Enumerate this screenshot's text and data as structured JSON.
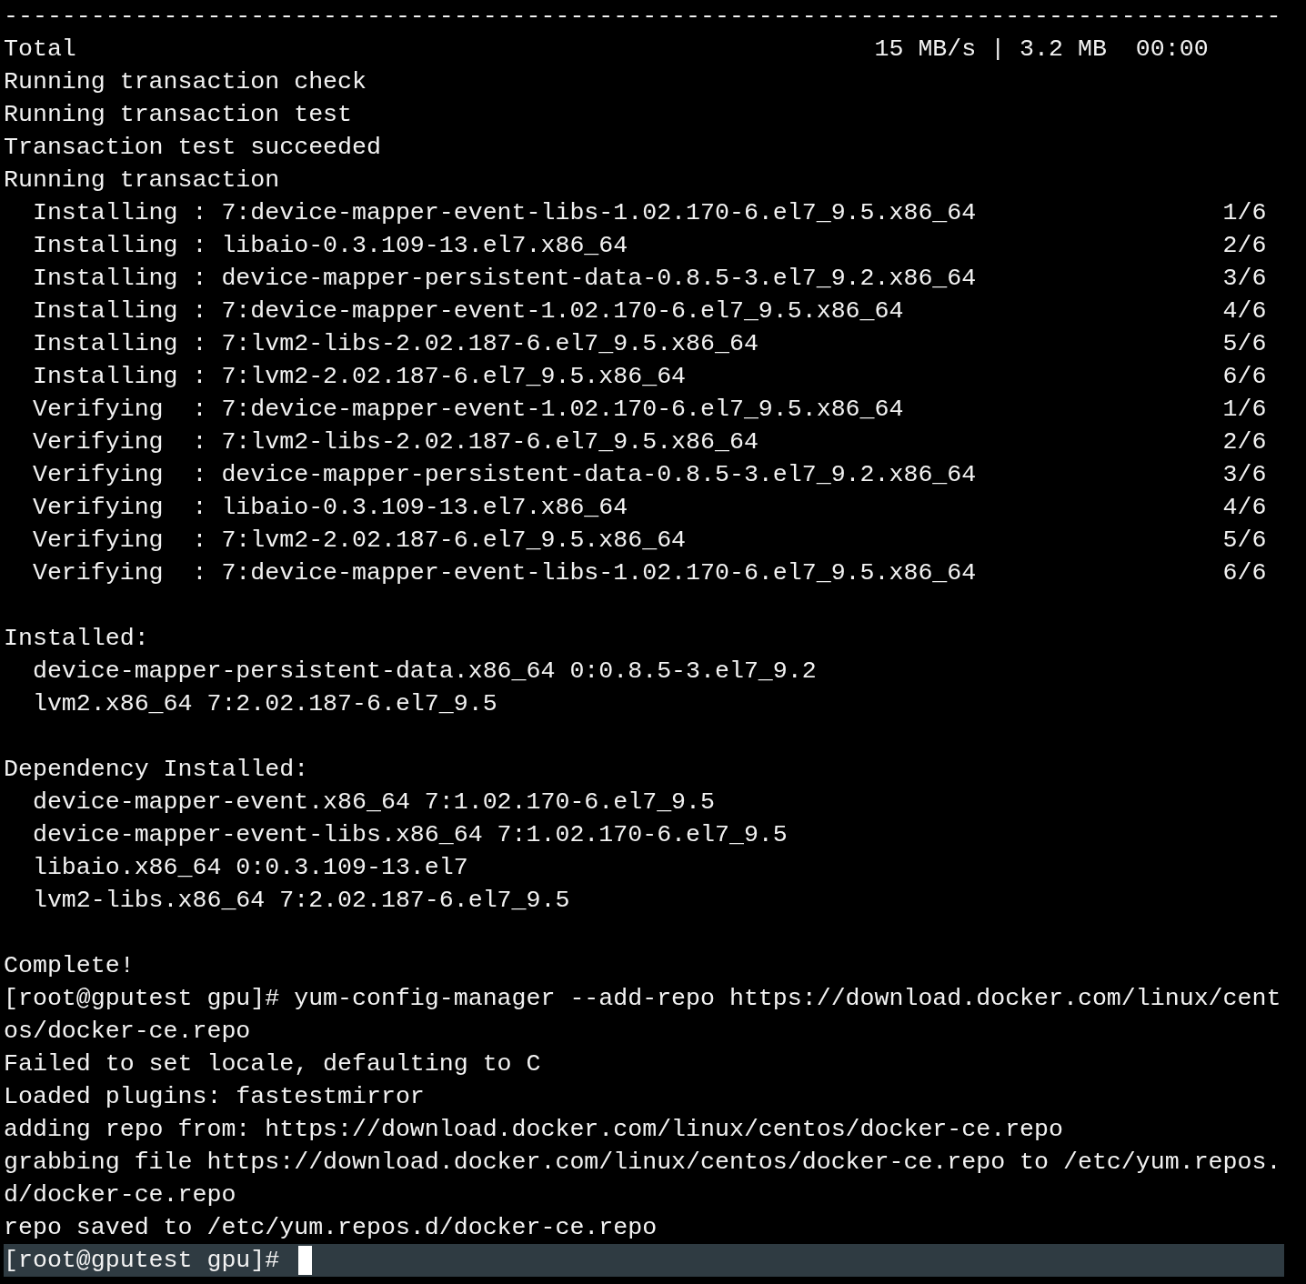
{
  "terminal": {
    "lines": [
      {
        "kind": "output",
        "text": "----------------------------------------------------------------------------------------"
      },
      {
        "kind": "output",
        "text": "Total                                                       15 MB/s | 3.2 MB  00:00"
      },
      {
        "kind": "output",
        "text": "Running transaction check"
      },
      {
        "kind": "output",
        "text": "Running transaction test"
      },
      {
        "kind": "output",
        "text": "Transaction test succeeded"
      },
      {
        "kind": "output",
        "text": "Running transaction"
      },
      {
        "kind": "output",
        "text": "  Installing : 7:device-mapper-event-libs-1.02.170-6.el7_9.5.x86_64                 1/6"
      },
      {
        "kind": "output",
        "text": "  Installing : libaio-0.3.109-13.el7.x86_64                                         2/6"
      },
      {
        "kind": "output",
        "text": "  Installing : device-mapper-persistent-data-0.8.5-3.el7_9.2.x86_64                 3/6"
      },
      {
        "kind": "output",
        "text": "  Installing : 7:device-mapper-event-1.02.170-6.el7_9.5.x86_64                      4/6"
      },
      {
        "kind": "output",
        "text": "  Installing : 7:lvm2-libs-2.02.187-6.el7_9.5.x86_64                                5/6"
      },
      {
        "kind": "output",
        "text": "  Installing : 7:lvm2-2.02.187-6.el7_9.5.x86_64                                     6/6"
      },
      {
        "kind": "output",
        "text": "  Verifying  : 7:device-mapper-event-1.02.170-6.el7_9.5.x86_64                      1/6"
      },
      {
        "kind": "output",
        "text": "  Verifying  : 7:lvm2-libs-2.02.187-6.el7_9.5.x86_64                                2/6"
      },
      {
        "kind": "output",
        "text": "  Verifying  : device-mapper-persistent-data-0.8.5-3.el7_9.2.x86_64                 3/6"
      },
      {
        "kind": "output",
        "text": "  Verifying  : libaio-0.3.109-13.el7.x86_64                                         4/6"
      },
      {
        "kind": "output",
        "text": "  Verifying  : 7:lvm2-2.02.187-6.el7_9.5.x86_64                                     5/6"
      },
      {
        "kind": "output",
        "text": "  Verifying  : 7:device-mapper-event-libs-1.02.170-6.el7_9.5.x86_64                 6/6"
      },
      {
        "kind": "blank"
      },
      {
        "kind": "output",
        "text": "Installed:"
      },
      {
        "kind": "output",
        "text": "  device-mapper-persistent-data.x86_64 0:0.8.5-3.el7_9.2"
      },
      {
        "kind": "output",
        "text": "  lvm2.x86_64 7:2.02.187-6.el7_9.5"
      },
      {
        "kind": "blank"
      },
      {
        "kind": "output",
        "text": "Dependency Installed:"
      },
      {
        "kind": "output",
        "text": "  device-mapper-event.x86_64 7:1.02.170-6.el7_9.5"
      },
      {
        "kind": "output",
        "text": "  device-mapper-event-libs.x86_64 7:1.02.170-6.el7_9.5"
      },
      {
        "kind": "output",
        "text": "  libaio.x86_64 0:0.3.109-13.el7"
      },
      {
        "kind": "output",
        "text": "  lvm2-libs.x86_64 7:2.02.187-6.el7_9.5"
      },
      {
        "kind": "blank"
      },
      {
        "kind": "output",
        "text": "Complete!"
      },
      {
        "kind": "output",
        "text": "[root@gputest gpu]# yum-config-manager --add-repo https://download.docker.com/linux/cent"
      },
      {
        "kind": "output",
        "text": "os/docker-ce.repo"
      },
      {
        "kind": "output",
        "text": "Failed to set locale, defaulting to C"
      },
      {
        "kind": "output",
        "text": "Loaded plugins: fastestmirror"
      },
      {
        "kind": "output",
        "text": "adding repo from: https://download.docker.com/linux/centos/docker-ce.repo"
      },
      {
        "kind": "output",
        "text": "grabbing file https://download.docker.com/linux/centos/docker-ce.repo to /etc/yum.repos."
      },
      {
        "kind": "output",
        "text": "d/docker-ce.repo"
      },
      {
        "kind": "output",
        "text": "repo saved to /etc/yum.repos.d/docker-ce.repo"
      },
      {
        "kind": "prompt",
        "text": "[root@gputest gpu]#",
        "highlighted": true,
        "cursor": true
      }
    ]
  }
}
